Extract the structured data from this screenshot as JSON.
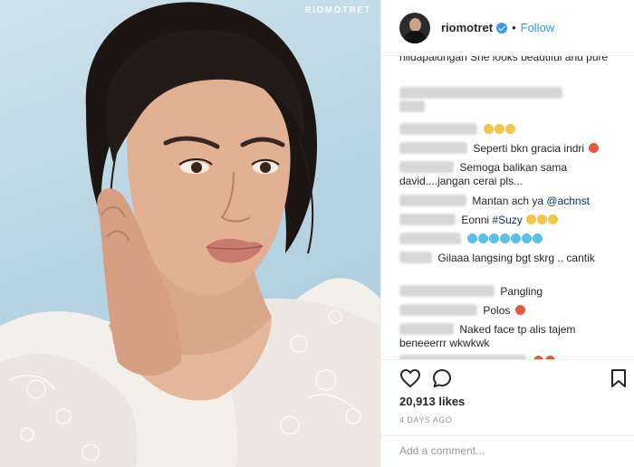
{
  "photo": {
    "watermark": "RIOMOTRET"
  },
  "header": {
    "username": "riomotret",
    "separator": "•",
    "follow_label": "Follow"
  },
  "comments": [
    {
      "text": "hildapalungan She looks beautiful and pure",
      "cut_top": true
    },
    {
      "text": "",
      "blurred": true
    },
    {
      "text": "",
      "emoji": "hands"
    },
    {
      "text": "Seperti bkn gracia indri",
      "emoji": "heart-eyes"
    },
    {
      "text": "Semoga balikan sama david....jangan cerai pls..."
    },
    {
      "text": "Mantan ach ya",
      "mention": "@achnst"
    },
    {
      "text": "Eonni",
      "hashtag": "#Suzy",
      "emoji": "kiss"
    },
    {
      "text": "",
      "emoji": "blue-hearts"
    },
    {
      "text": "Gilaaa langsing bgt skrg .. cantik"
    },
    {
      "text": "Pangling"
    },
    {
      "text": "Polos",
      "emoji": "heart-eyes"
    },
    {
      "text": "Naked face tp alis tajem beneeerrr wkwkwk"
    }
  ],
  "actions": {
    "like_icon": "heart-outline-icon",
    "comment_icon": "speech-bubble-icon",
    "bookmark_icon": "bookmark-icon"
  },
  "likes": "20,913 likes",
  "timestamp": "4 DAYS AGO",
  "add_comment": {
    "placeholder": "Add a comment..."
  },
  "colors": {
    "link": "#3897f0",
    "text": "#262626",
    "muted": "#999999",
    "border": "#efefef"
  }
}
